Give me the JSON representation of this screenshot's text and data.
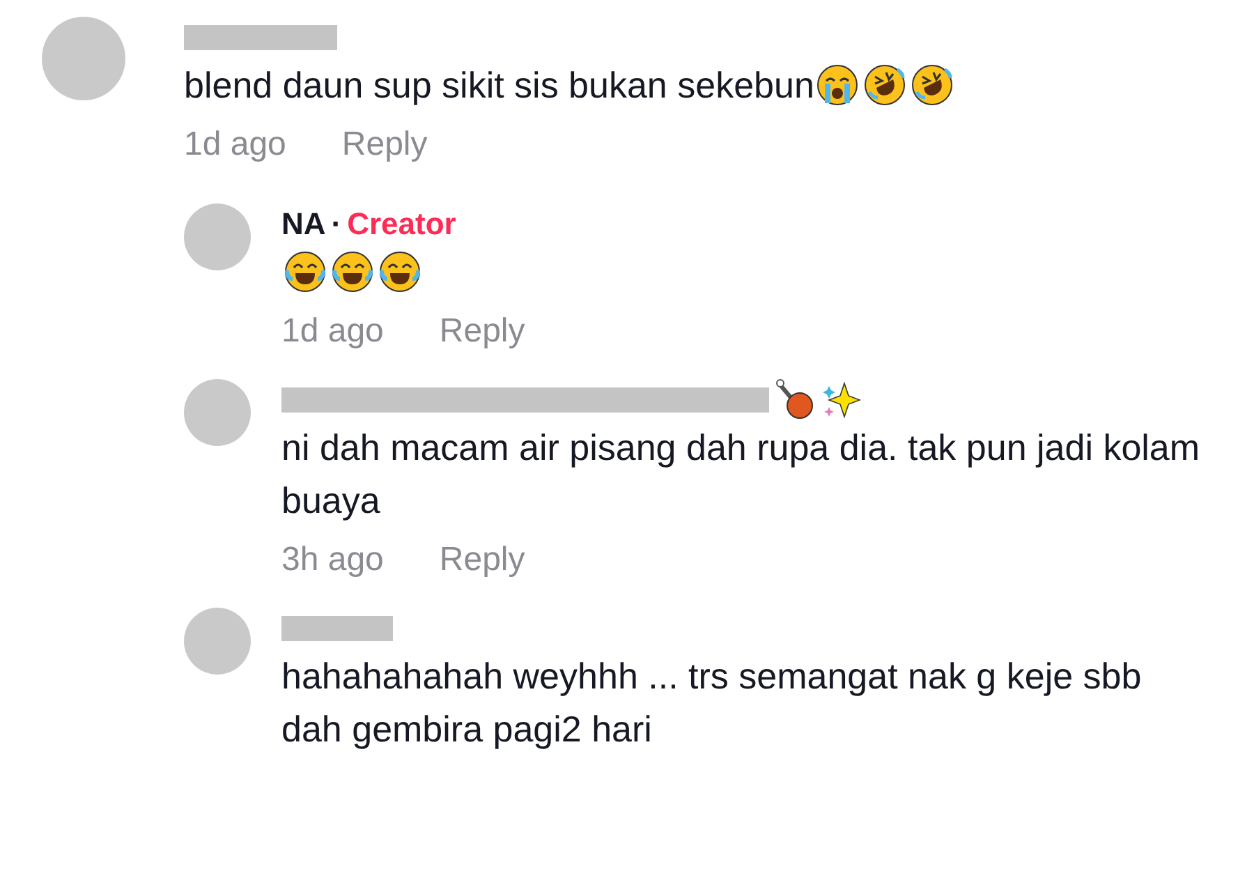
{
  "comments": [
    {
      "text": "blend daun sup sikit sis bukan sekebun",
      "emojis": [
        {
          "kind": "crying"
        },
        {
          "kind": "rofl"
        },
        {
          "kind": "rofl"
        }
      ],
      "time": "1d ago",
      "reply": "Reply",
      "replies": [
        {
          "author": "NA",
          "separator": "·",
          "badge": "Creator",
          "emojis": [
            {
              "kind": "joy"
            },
            {
              "kind": "joy"
            },
            {
              "kind": "joy"
            }
          ],
          "time": "1d ago",
          "reply": "Reply"
        },
        {
          "text": "ni dah macam air pisang dah rupa dia. tak pun jadi kolam buaya",
          "name_emojis": [
            {
              "kind": "drumstick"
            },
            {
              "kind": "sparkles"
            }
          ],
          "time": "3h ago",
          "reply": "Reply"
        },
        {
          "text": "hahahahahah weyhhh ... trs semangat nak g keje sbb dah gembira pagi2 hari"
        }
      ]
    }
  ]
}
